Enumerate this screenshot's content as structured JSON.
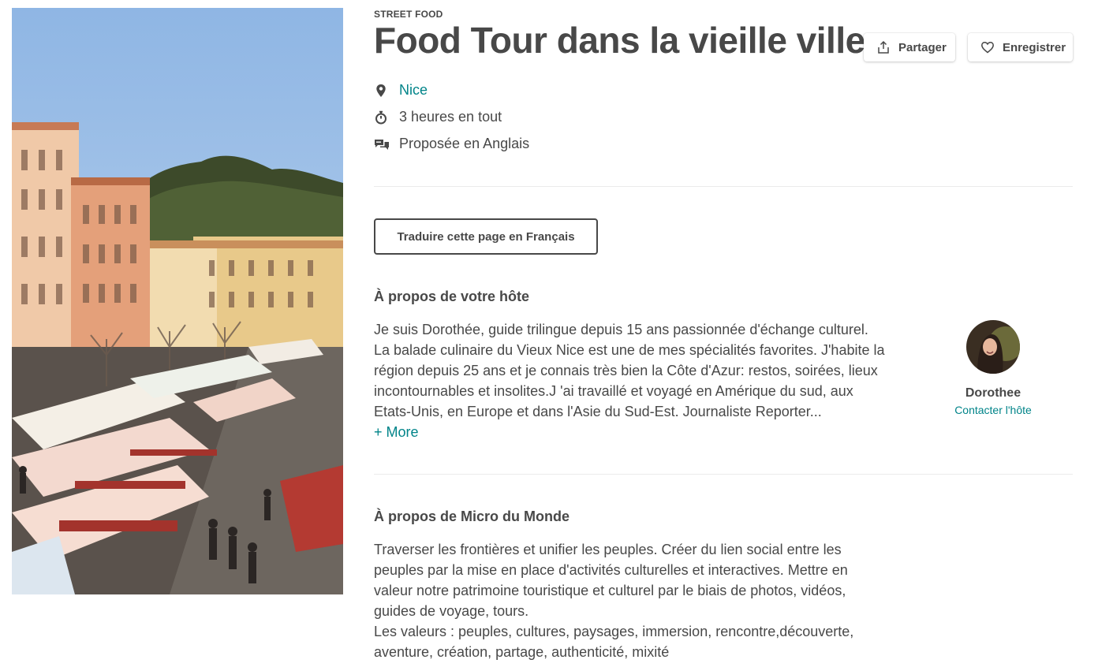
{
  "experience": {
    "category": "STREET FOOD",
    "title": "Food Tour dans la vieille ville"
  },
  "actions": {
    "share_label": "Partager",
    "save_label": "Enregistrer"
  },
  "details": {
    "location": "Nice",
    "duration": "3 heures en tout",
    "language": "Proposée en Anglais"
  },
  "translate_label": "Traduire cette page en Français",
  "host_section": {
    "heading": "À propos de votre hôte",
    "bio": "Je suis Dorothée, guide trilingue depuis 15 ans passionnée d'échange culturel. La balade culinaire du Vieux Nice est une de mes spécialités favorites. J'habite la région depuis 25 ans et je connais très bien la Côte d'Azur: restos, soirées, lieux incontournables et insolites.J 'ai travaillé et voyagé en Amérique du sud, aux Etats-Unis, en Europe et dans l'Asie du Sud-Est. Journaliste Reporter...",
    "more_label": "+ More",
    "host_name": "Dorothee",
    "contact_label": "Contacter l'hôte"
  },
  "org_section": {
    "heading": "À propos de Micro du Monde",
    "description": "Traverser les frontières et unifier les peuples. Créer du lien social entre les peuples par la mise en place d'activités culturelles et interactives. Mettre en valeur notre patrimoine touristique et culturel par le biais de photos, vidéos, guides de voyage, tours.",
    "values": "Les valeurs : peuples, cultures, paysages, immersion, rencontre,découverte, aventure, création, partage, authenticité, mixité"
  },
  "icons": {
    "share": "share-icon",
    "save": "heart-icon",
    "location": "map-pin-icon",
    "duration": "stopwatch-icon",
    "language": "chat-bubbles-icon"
  },
  "colors": {
    "accent": "#008489",
    "text": "#484848",
    "divider": "#ebebeb"
  }
}
